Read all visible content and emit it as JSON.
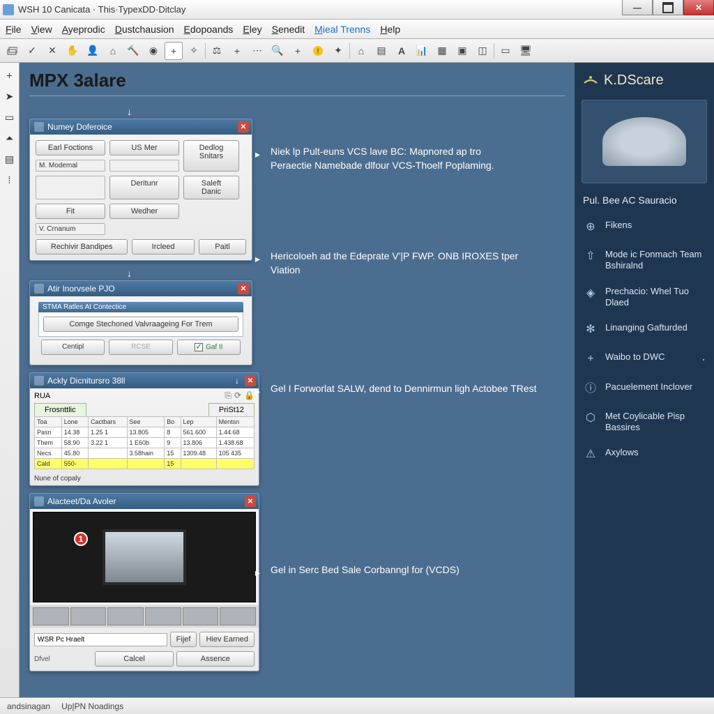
{
  "window": {
    "title": "WSH 10 Canicata · This·TypexDD·Ditclay"
  },
  "menu": [
    "File",
    "View",
    "Ayeprodic",
    "Dustchausion",
    "Edopoands",
    "Eley",
    "Senedit",
    "Mieal Trenns",
    "Help"
  ],
  "toolbar_count": 28,
  "page": {
    "title": "MPX 3alare"
  },
  "panel1": {
    "title": "Numey Doferoice",
    "fields": {
      "earl": "Earl Foctions",
      "mmodemal": "M. Modemal",
      "usmer": "US Mer",
      "deadog": "Dedlog",
      "snitars": "Snitars",
      "deritunr": "Deritunr",
      "saleft": "Saleft",
      "danic": "Danic",
      "fit": "Fit",
      "wedher": "Wedher",
      "crnanum": "V. Crnanum"
    },
    "btn_rechivir": "Rechivir Bandipes",
    "btn_excleed": "Ircleed",
    "btn_paitl": "Paitl"
  },
  "panel2": {
    "title": "Atir Inorvsele PJO",
    "boxhdr": "STMA Ratles At Contectice",
    "btn_comge": "Comge Stechoned Valvraageing For Trem",
    "btn_centipl": "Centipl",
    "btn_rcse": "RCSE",
    "btn_gaf": "Gaf II"
  },
  "panel3": {
    "title": "Ackly Dicnitursro 38ll",
    "sub": "RUA",
    "tab1": "Frosnttlic",
    "tab2": "PriSt12",
    "headers": [
      "Toa",
      "Lone",
      "Cactbars",
      "See",
      "Bo",
      "Lep",
      "Mentsn"
    ],
    "rows": [
      [
        "Pasn",
        "14.38",
        "1.25 1",
        "13.805",
        "8",
        "561.600",
        "1.44.68"
      ],
      [
        "Them",
        "58.90",
        "3.22 1",
        "1 E60b",
        "9",
        "13.806",
        "1.438.68"
      ],
      [
        "Necs",
        "45.80",
        "",
        "3.58hain",
        "15",
        "1309.48",
        "105 435"
      ],
      [
        "Cald",
        "550-",
        "",
        "",
        "15",
        "",
        ""
      ]
    ],
    "footer": "Nune of copaly"
  },
  "panel4": {
    "title": "Alacteet/Da Avoler",
    "badge": "1",
    "inputval": "WSR Pc Hraelt",
    "lbl_dfvel": "Dfvel",
    "btn_fijef": "Fijef",
    "btn_hiev": "Hiev Earned",
    "btn_calcel": "Calcel",
    "btn_assence": "Assence"
  },
  "callouts": {
    "c1": "Niek lp Pult-euns VCS lave BC: Mapnored ap tro Peraectie Namebade dlfour VCS-Thoelf Poplaming.",
    "c2": "Hericoloeh ad the Edeprate V'|P FWP. ONB IROXES tper Viation",
    "c3": "Gel I Forworlat SALW, dend to Dennirmun ligh Actobee TRest",
    "c4": "Gel in Serc Bed Sale Corbanngl for (VCDS)"
  },
  "sidebar": {
    "brand": "K.DScare",
    "heading": "Pul. Bee AC Sauracio",
    "items": [
      "Fikens",
      "Mode ic Fonmach Team Bshiralnd",
      "Prechacio: Whel Tuo Dlaed",
      "Linanging Gafturded",
      "Waibo to DWC",
      "Pacuelement Inclover",
      "Met Coylicable Pisp Bassires",
      "Axylows"
    ]
  },
  "status": {
    "a": "andsinagan",
    "b": "Up|PN Noadings"
  }
}
